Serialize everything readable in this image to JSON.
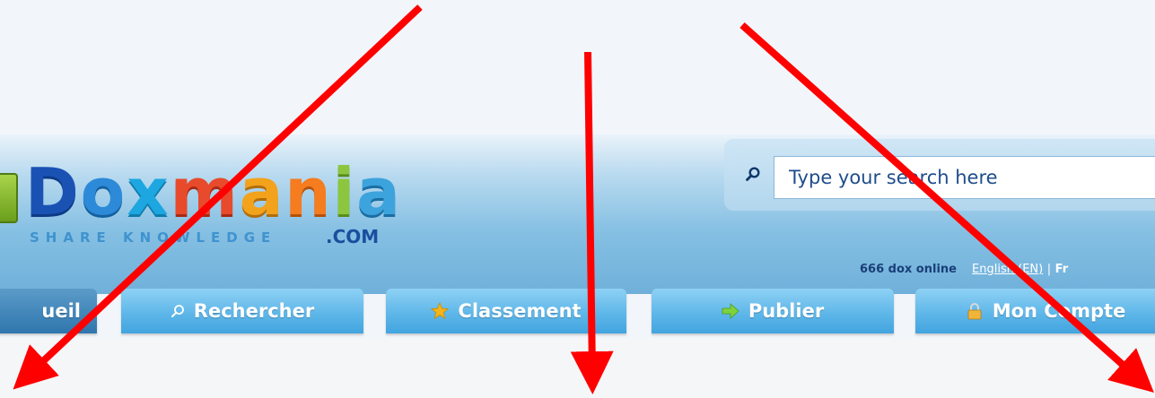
{
  "logo": {
    "word": [
      "D",
      "o",
      "x",
      "m",
      "a",
      "n",
      "i",
      "a"
    ],
    "tagline": "SHARE KNOWLEDGE",
    "domain": ".COM"
  },
  "search": {
    "placeholder": "Type your search here",
    "icon": "search-icon"
  },
  "toplinks": {
    "online": "666 dox online",
    "lang_en": "English (EN)",
    "separator": "|",
    "lang_fr": "Fr"
  },
  "nav": {
    "tabs": [
      {
        "label": "ueil",
        "icon": "",
        "active": true
      },
      {
        "label": "Rechercher",
        "icon": "search-icon"
      },
      {
        "label": "Classement",
        "icon": "star-icon"
      },
      {
        "label": "Publier",
        "icon": "arrow-right-icon"
      },
      {
        "label": "Mon Compte",
        "icon": "lock-icon"
      }
    ]
  },
  "colors": {
    "arrow": "#ff0000",
    "tab": "#5fb7e9",
    "tab_active": "#2f76ad",
    "header_blue": "#86c0e3",
    "dox_online": "#1a3f78"
  }
}
